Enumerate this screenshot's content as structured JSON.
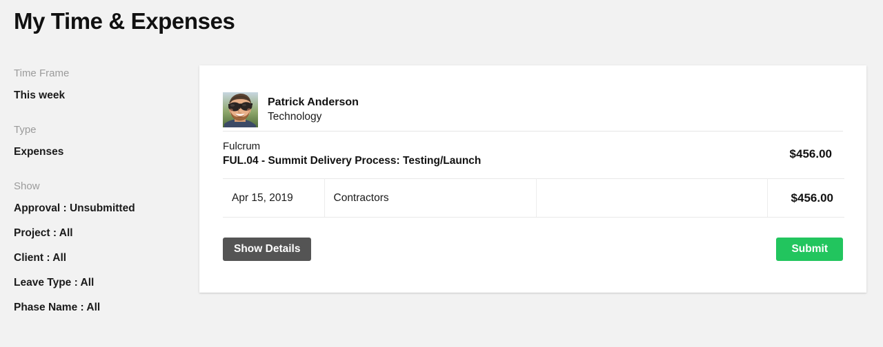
{
  "page": {
    "title": "My Time & Expenses",
    "background_color": "#f2f2f2"
  },
  "sidebar": {
    "groups": [
      {
        "label": "Time Frame",
        "value": "This week"
      },
      {
        "label": "Type",
        "value": "Expenses"
      }
    ],
    "show": {
      "label": "Show",
      "filters": [
        {
          "name": "Approval",
          "separator": " : ",
          "value": "Unsubmitted",
          "emphasized": true
        },
        {
          "name": "Project",
          "separator": " : ",
          "value": "All",
          "emphasized": false
        },
        {
          "name": "Client",
          "separator": " : ",
          "value": "All",
          "emphasized": false
        },
        {
          "name": "Leave Type",
          "separator": " : ",
          "value": "All",
          "emphasized": false
        },
        {
          "name": "Phase Name",
          "separator": " : ",
          "value": "All",
          "emphasized": false
        }
      ]
    }
  },
  "card": {
    "person": {
      "avatar_alt": "avatar-photo",
      "name": "Patrick Anderson",
      "department": "Technology"
    },
    "project": {
      "client": "Fulcrum",
      "name": "FUL.04 - Summit Delivery Process: Testing/Launch",
      "total": "$456.00"
    },
    "expenses": [
      {
        "date": "Apr 15, 2019",
        "category": "Contractors",
        "note": "",
        "amount": "$456.00"
      }
    ],
    "actions": {
      "show_details_label": "Show Details",
      "submit_label": "Submit",
      "show_details_color": "#545454",
      "submit_color": "#22c55e"
    }
  }
}
